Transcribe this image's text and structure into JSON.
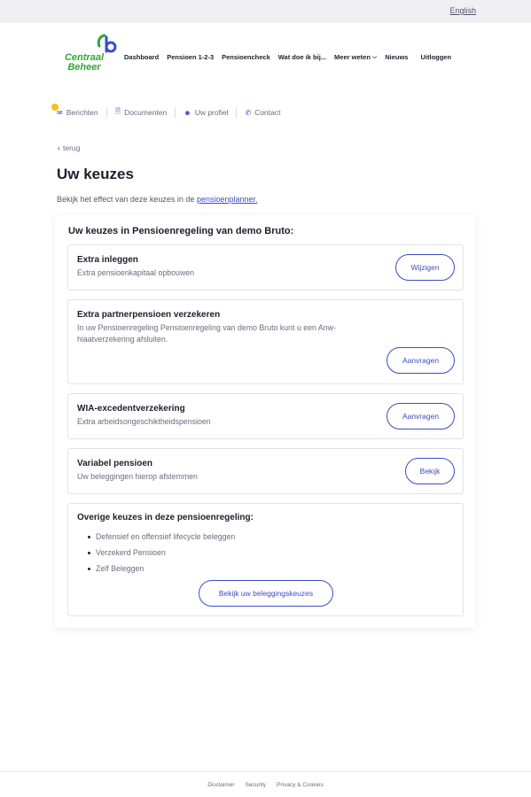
{
  "topbar": {
    "language": "English"
  },
  "logo": {
    "line1": "Centraal",
    "line2": "Beheer"
  },
  "nav": {
    "items": [
      {
        "label": "Dashboard"
      },
      {
        "label": "Pensioen 1-2-3"
      },
      {
        "label": "Pensioencheck"
      },
      {
        "label": "Wat doe ik bij..."
      },
      {
        "label": "Meer weten"
      },
      {
        "label": "Nieuws"
      }
    ],
    "logout": "Uitloggen"
  },
  "subnav": {
    "items": [
      {
        "label": "Berichten",
        "icon": "mail-icon"
      },
      {
        "label": "Documenten",
        "icon": "document-icon"
      },
      {
        "label": "Uw profiel",
        "icon": "user-icon"
      },
      {
        "label": "Contact",
        "icon": "phone-icon"
      }
    ]
  },
  "back": "terug",
  "page": {
    "title": "Uw keuzes",
    "intro_text": "Bekijk het effect van deze keuzes in de ",
    "intro_link": "pensioenplanner."
  },
  "panel": {
    "title": "Uw keuzes in Pensioenregeling van demo Bruto:",
    "cards": [
      {
        "title": "Extra inleggen",
        "desc": "Extra pensioenkapitaal opbouwen",
        "button": "Wijzigen"
      },
      {
        "title": "Extra partnerpensioen verzekeren",
        "desc_line1": "In uw Pensioenregeling Pensioenregeling van demo Bruto kunt u een Anw-",
        "desc_line2": "hiaatverzekering afsluiten.",
        "button": "Aanvragen"
      },
      {
        "title": "WIA-excedentverzekering",
        "desc": "Extra arbeidsongeschiktheidspensioen",
        "button": "Aanvragen"
      },
      {
        "title": "Variabel pensioen",
        "desc": "Uw beleggingen hierop afstemmen",
        "button": "Bekijk"
      }
    ],
    "other": {
      "title": "Overige keuzes in deze pensioenregeling:",
      "items": [
        "Defensief en offensief lifecycle beleggen",
        "Verzekerd Pensioen",
        "Zelf Beleggen"
      ],
      "button": "Bekijk uw beleggingskeuzes"
    }
  },
  "footer": {
    "links": [
      "Disclaimer",
      "Security",
      "Privacy & Cookies"
    ]
  },
  "colors": {
    "accent": "#3b4cc8",
    "brand_green": "#2ea836",
    "notification": "#f4c21d"
  }
}
